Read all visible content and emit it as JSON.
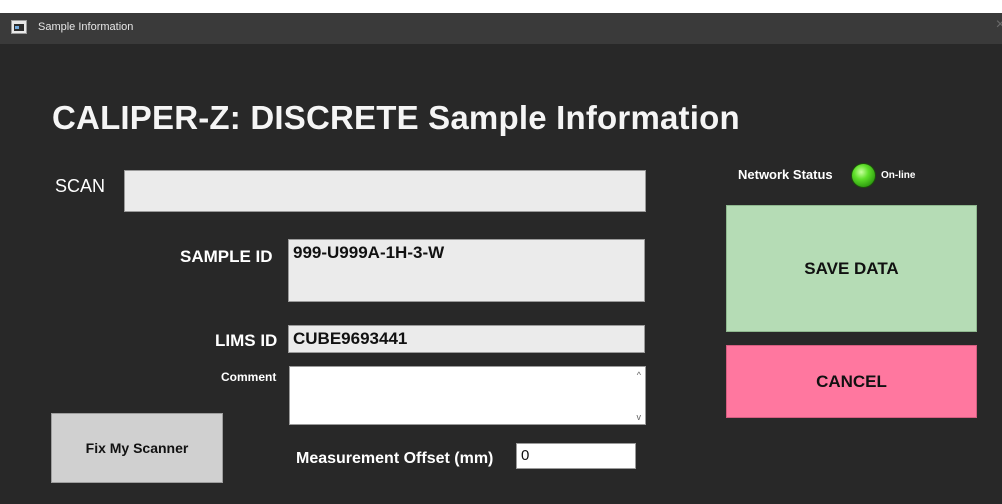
{
  "window": {
    "title": "Sample Information",
    "close_glyph": "×"
  },
  "heading": "CALIPER-Z: DISCRETE Sample Information",
  "scan": {
    "label": "SCAN",
    "value": ""
  },
  "sample_id": {
    "label": "SAMPLE ID",
    "value": "999-U999A-1H-3-W"
  },
  "lims_id": {
    "label": "LIMS ID",
    "value": "CUBE9693441"
  },
  "comment": {
    "label": "Comment",
    "value": "",
    "scroll_up_glyph": "^",
    "scroll_down_glyph": "v"
  },
  "offset": {
    "label": "Measurement Offset (mm)",
    "value": "0"
  },
  "buttons": {
    "fix_scanner": "Fix My Scanner",
    "save": "SAVE DATA",
    "cancel": "CANCEL"
  },
  "network": {
    "label": "Network Status",
    "status": "On-line",
    "status_color": "#5fe02a"
  },
  "colors": {
    "background": "#282828",
    "save_button": "#b5dcb5",
    "cancel_button": "#ff779f"
  }
}
